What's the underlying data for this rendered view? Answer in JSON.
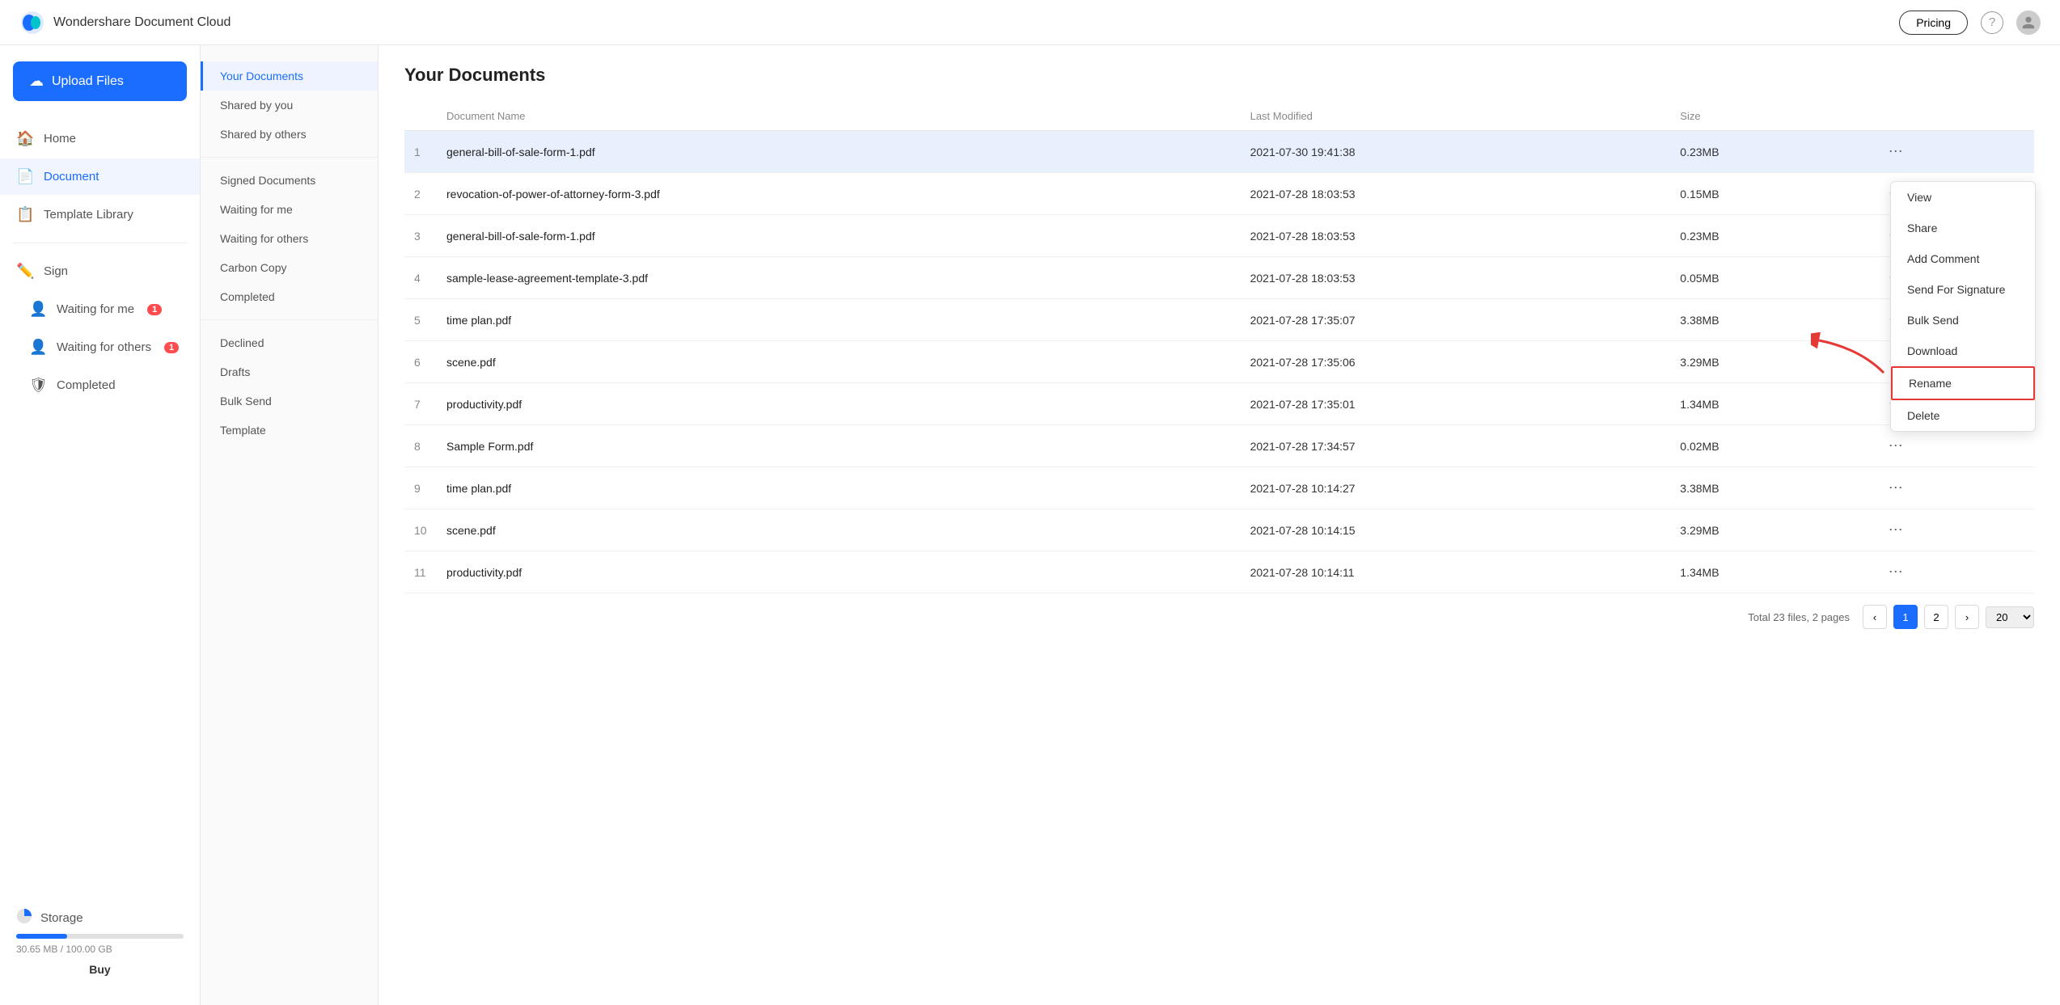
{
  "app": {
    "name": "Wondershare Document Cloud",
    "pricing_btn": "Pricing"
  },
  "upload_btn": "Upload Files",
  "nav": {
    "items": [
      {
        "id": "home",
        "label": "Home",
        "icon": "🏠",
        "active": false
      },
      {
        "id": "document",
        "label": "Document",
        "icon": "📄",
        "active": true
      },
      {
        "id": "template",
        "label": "Template Library",
        "icon": "📋",
        "active": false
      }
    ],
    "sign_header": "Sign",
    "waiting_for_me": "Waiting for me",
    "waiting_for_me_badge": "1",
    "waiting_for_others": "Waiting for others",
    "waiting_for_others_badge": "1",
    "completed": "Completed"
  },
  "storage": {
    "title": "Storage",
    "used": "30.65 MB / 100.00 GB",
    "buy_btn": "Buy",
    "fill_percent": 30.65
  },
  "sub_sidebar": {
    "items": [
      {
        "id": "your-documents",
        "label": "Your Documents",
        "active": true
      },
      {
        "id": "shared-by-you",
        "label": "Shared by you",
        "active": false
      },
      {
        "id": "shared-by-others",
        "label": "Shared by others",
        "active": false
      },
      {
        "id": "signed-documents",
        "label": "Signed Documents",
        "active": false
      },
      {
        "id": "waiting-for-me",
        "label": "Waiting for me",
        "active": false
      },
      {
        "id": "waiting-for-others",
        "label": "Waiting for others",
        "active": false
      },
      {
        "id": "carbon-copy",
        "label": "Carbon Copy",
        "active": false
      },
      {
        "id": "completed",
        "label": "Completed",
        "active": false
      },
      {
        "id": "declined",
        "label": "Declined",
        "active": false
      },
      {
        "id": "drafts",
        "label": "Drafts",
        "active": false
      },
      {
        "id": "bulk-send",
        "label": "Bulk Send",
        "active": false
      },
      {
        "id": "template",
        "label": "Template",
        "active": false
      }
    ]
  },
  "main": {
    "title": "Your Documents",
    "columns": [
      "Document Name",
      "Last Modified",
      "Size"
    ],
    "rows": [
      {
        "num": "1",
        "name": "general-bill-of-sale-form-1.pdf",
        "modified": "2021-07-30 19:41:38",
        "size": "0.23MB",
        "highlighted": true
      },
      {
        "num": "2",
        "name": "revocation-of-power-of-attorney-form-3.pdf",
        "modified": "2021-07-28 18:03:53",
        "size": "0.15MB",
        "highlighted": false
      },
      {
        "num": "3",
        "name": "general-bill-of-sale-form-1.pdf",
        "modified": "2021-07-28 18:03:53",
        "size": "0.23MB",
        "highlighted": false
      },
      {
        "num": "4",
        "name": "sample-lease-agreement-template-3.pdf",
        "modified": "2021-07-28 18:03:53",
        "size": "0.05MB",
        "highlighted": false
      },
      {
        "num": "5",
        "name": "time plan.pdf",
        "modified": "2021-07-28 17:35:07",
        "size": "3.38MB",
        "highlighted": false
      },
      {
        "num": "6",
        "name": "scene.pdf",
        "modified": "2021-07-28 17:35:06",
        "size": "3.29MB",
        "highlighted": false
      },
      {
        "num": "7",
        "name": "productivity.pdf",
        "modified": "2021-07-28 17:35:01",
        "size": "1.34MB",
        "highlighted": false
      },
      {
        "num": "8",
        "name": "Sample Form.pdf",
        "modified": "2021-07-28 17:34:57",
        "size": "0.02MB",
        "highlighted": false
      },
      {
        "num": "9",
        "name": "time plan.pdf",
        "modified": "2021-07-28 10:14:27",
        "size": "3.38MB",
        "highlighted": false
      },
      {
        "num": "10",
        "name": "scene.pdf",
        "modified": "2021-07-28 10:14:15",
        "size": "3.29MB",
        "highlighted": false
      },
      {
        "num": "11",
        "name": "productivity.pdf",
        "modified": "2021-07-28 10:14:11",
        "size": "1.34MB",
        "highlighted": false
      }
    ],
    "pagination": {
      "total_text": "Total 23 files, 2 pages",
      "current_page": "1",
      "next_page": "2",
      "per_page": "20"
    }
  },
  "context_menu": {
    "items": [
      {
        "id": "view",
        "label": "View",
        "highlighted": false
      },
      {
        "id": "share",
        "label": "Share",
        "highlighted": false
      },
      {
        "id": "add-comment",
        "label": "Add Comment",
        "highlighted": false
      },
      {
        "id": "send-for-signature",
        "label": "Send For Signature",
        "highlighted": false
      },
      {
        "id": "bulk-send",
        "label": "Bulk Send",
        "highlighted": false
      },
      {
        "id": "download",
        "label": "Download",
        "highlighted": false
      },
      {
        "id": "rename",
        "label": "Rename",
        "highlighted": true
      },
      {
        "id": "delete",
        "label": "Delete",
        "highlighted": false
      }
    ]
  }
}
